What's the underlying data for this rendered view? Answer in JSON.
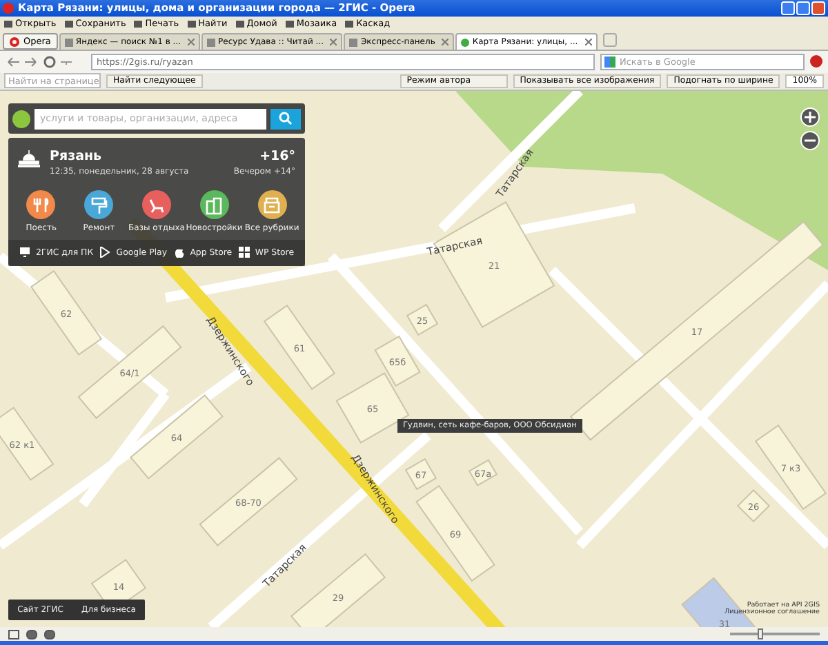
{
  "window": {
    "title": "Карта Рязани: улицы, дома и организации города — 2ГИС - Opera"
  },
  "menu": [
    {
      "label": "Открыть"
    },
    {
      "label": "Сохранить"
    },
    {
      "label": "Печать"
    },
    {
      "label": "Найти"
    },
    {
      "label": "Домой"
    },
    {
      "label": "Мозаика"
    },
    {
      "label": "Каскад"
    }
  ],
  "opera_button": "Opera",
  "tabs": [
    {
      "label": "Яндекс — поиск №1 в ...",
      "selected": false
    },
    {
      "label": "Ресурс Удава :: Читай ...",
      "selected": false
    },
    {
      "label": "Экспресс-панель",
      "selected": false
    },
    {
      "label": "Карта Рязани: улицы, ...",
      "selected": true
    }
  ],
  "address": {
    "url": "https://2gis.ru/ryazan",
    "search_placeholder": "Искать в Google"
  },
  "find_bar": {
    "placeholder": "Найти на странице",
    "find_next": "Найти следующее",
    "author_mode": "Режим автора",
    "show_images": "Показывать все изображения",
    "fit_width": "Подогнать по ширине",
    "zoom": "100%"
  },
  "panel": {
    "search_placeholder": "услуги и товары, организации, адреса",
    "city": "Рязань",
    "datetime": "12:35, понедельник, 28 августа",
    "temperature": "+16°",
    "evening": "Вечером +14°",
    "categories": [
      {
        "label": "Поесть",
        "kind": "food",
        "color": "#f0894a"
      },
      {
        "label": "Ремонт",
        "kind": "roller",
        "color": "#4aa8d8"
      },
      {
        "label": "Базы отдыха",
        "kind": "chair",
        "color": "#e8605e"
      },
      {
        "label": "Новостройки",
        "kind": "building",
        "color": "#5cb85c"
      },
      {
        "label": "Все рубрики",
        "kind": "box",
        "color": "#e0b050"
      }
    ],
    "apps": [
      {
        "label": "2ГИС для ПК",
        "kind": "pc"
      },
      {
        "label": "Google Play",
        "kind": "play"
      },
      {
        "label": "App Store",
        "kind": "apple"
      },
      {
        "label": "WP Store",
        "kind": "windows"
      }
    ]
  },
  "map": {
    "streets": [
      {
        "label": "Татарская"
      },
      {
        "label": "Татарская"
      },
      {
        "label": "Дзержинского"
      },
      {
        "label": "Дзержинского"
      },
      {
        "label": "Татарская"
      }
    ],
    "buildings": [
      {
        "number": "21"
      },
      {
        "number": "25"
      },
      {
        "number": "62"
      },
      {
        "number": "61"
      },
      {
        "number": "64/1"
      },
      {
        "number": "65б"
      },
      {
        "number": "65"
      },
      {
        "number": "64"
      },
      {
        "number": "62 к1"
      },
      {
        "number": "17"
      },
      {
        "number": "67"
      },
      {
        "number": "67а"
      },
      {
        "number": "68-70"
      },
      {
        "number": "69"
      },
      {
        "number": "14"
      },
      {
        "number": "29"
      },
      {
        "number": "7 к3"
      },
      {
        "number": "26"
      },
      {
        "number": "31"
      }
    ],
    "tooltip": "Гудвин, сеть кафе-баров, ООО Обсидиан",
    "footer_links": [
      {
        "label": "Сайт 2ГИС"
      },
      {
        "label": "Для бизнеса"
      }
    ],
    "attribution": [
      "Работает на API 2GIS",
      "Лицензионное соглашение"
    ]
  },
  "status_bar": {
    "zoom_slider": {
      "level": 0.3
    }
  }
}
